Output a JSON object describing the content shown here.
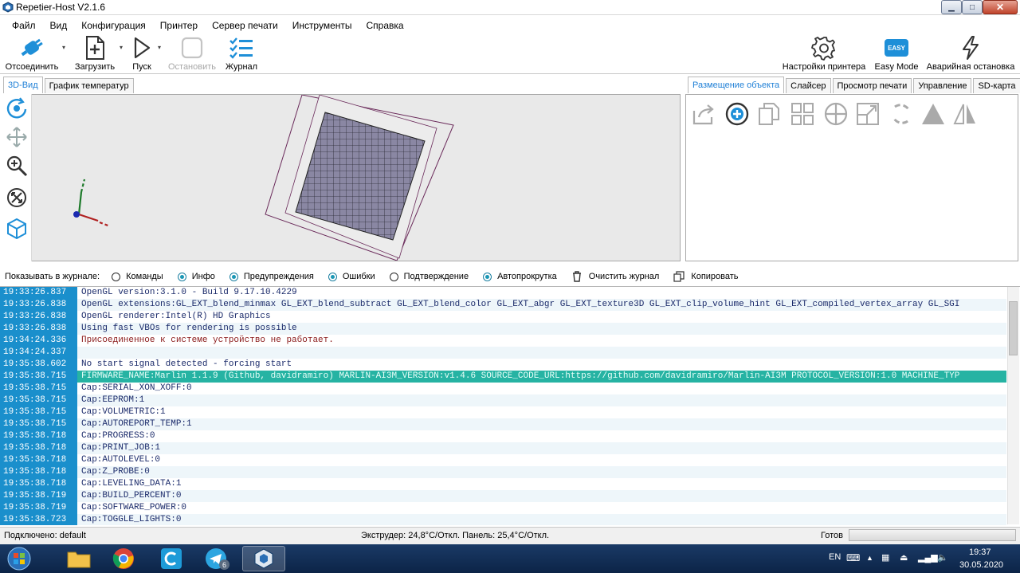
{
  "window": {
    "title": "Repetier-Host V2.1.6"
  },
  "menu": [
    "Файл",
    "Вид",
    "Конфигурация",
    "Принтер",
    "Сервер печати",
    "Инструменты",
    "Справка"
  ],
  "toolbar": {
    "disconnect": "Отсоединить",
    "load": "Загрузить",
    "start": "Пуск",
    "stop": "Остановить",
    "log": "Журнал",
    "printer_settings": "Настройки принтера",
    "easy_badge": "EASY",
    "easy_mode": "Easy Mode",
    "emergency": "Аварийная остановка"
  },
  "left_tabs": [
    "3D-Вид",
    "График температур"
  ],
  "right_tabs": [
    "Размещение объекта",
    "Слайсер",
    "Просмотр печати",
    "Управление",
    "SD-карта"
  ],
  "log_filter": {
    "label": "Показывать в журнале:",
    "options": [
      {
        "label": "Команды",
        "checked": false
      },
      {
        "label": "Инфо",
        "checked": true
      },
      {
        "label": "Предупреждения",
        "checked": true
      },
      {
        "label": "Ошибки",
        "checked": true
      },
      {
        "label": "Подтверждение",
        "checked": false
      },
      {
        "label": "Автопрокрутка",
        "checked": true
      }
    ],
    "clear": "Очистить журнал",
    "copy": "Копировать"
  },
  "log": [
    {
      "time": "19:33:26.837",
      "msg": "OpenGL version:3.1.0 - Build 9.17.10.4229",
      "kind": "info"
    },
    {
      "time": "19:33:26.838",
      "msg": "OpenGL extensions:GL_EXT_blend_minmax GL_EXT_blend_subtract GL_EXT_blend_color GL_EXT_abgr GL_EXT_texture3D GL_EXT_clip_volume_hint GL_EXT_compiled_vertex_array GL_SGI",
      "kind": "info"
    },
    {
      "time": "19:33:26.838",
      "msg": "OpenGL renderer:Intel(R) HD Graphics",
      "kind": "info"
    },
    {
      "time": "19:33:26.838",
      "msg": "Using fast VBOs for rendering is possible",
      "kind": "info"
    },
    {
      "time": "19:34:24.336",
      "msg": "Присоединенное к системе устройство не работает.",
      "kind": "error"
    },
    {
      "time": "19:34:24.337",
      "msg": "",
      "kind": "info"
    },
    {
      "time": "19:35:38.602",
      "msg": "No start signal detected - forcing start",
      "kind": "info"
    },
    {
      "time": "19:35:38.715",
      "msg": "FIRMWARE_NAME:Marlin 1.1.9 (Github, davidramiro) MARLIN-AI3M_VERSION:v1.4.6 SOURCE_CODE_URL:https://github.com/davidramiro/Marlin-AI3M PROTOCOL_VERSION:1.0 MACHINE_TYP",
      "kind": "highlight"
    },
    {
      "time": "19:35:38.715",
      "msg": "Cap:SERIAL_XON_XOFF:0",
      "kind": "info"
    },
    {
      "time": "19:35:38.715",
      "msg": "Cap:EEPROM:1",
      "kind": "info"
    },
    {
      "time": "19:35:38.715",
      "msg": "Cap:VOLUMETRIC:1",
      "kind": "info"
    },
    {
      "time": "19:35:38.715",
      "msg": "Cap:AUTOREPORT_TEMP:1",
      "kind": "info"
    },
    {
      "time": "19:35:38.718",
      "msg": "Cap:PROGRESS:0",
      "kind": "info"
    },
    {
      "time": "19:35:38.718",
      "msg": "Cap:PRINT_JOB:1",
      "kind": "info"
    },
    {
      "time": "19:35:38.718",
      "msg": "Cap:AUTOLEVEL:0",
      "kind": "info"
    },
    {
      "time": "19:35:38.718",
      "msg": "Cap:Z_PROBE:0",
      "kind": "info"
    },
    {
      "time": "19:35:38.718",
      "msg": "Cap:LEVELING_DATA:1",
      "kind": "info"
    },
    {
      "time": "19:35:38.719",
      "msg": "Cap:BUILD_PERCENT:0",
      "kind": "info"
    },
    {
      "time": "19:35:38.719",
      "msg": "Cap:SOFTWARE_POWER:0",
      "kind": "info"
    },
    {
      "time": "19:35:38.723",
      "msg": "Cap:TOGGLE_LIGHTS:0",
      "kind": "info"
    }
  ],
  "status": {
    "connection": "Подключено: default",
    "temps": "Экструдер: 24,8°C/Откл. Панель: 25,4°C/Откл.",
    "state": "Готов"
  },
  "taskbar": {
    "lang": "EN",
    "time": "19:37",
    "date": "30.05.2020",
    "telegram_badge": "6"
  },
  "colors": {
    "accent": "#1a8fcc",
    "highlight_row": "#26b3a3",
    "error_text": "#8a1a1a",
    "taskbar": "#0c2447"
  }
}
